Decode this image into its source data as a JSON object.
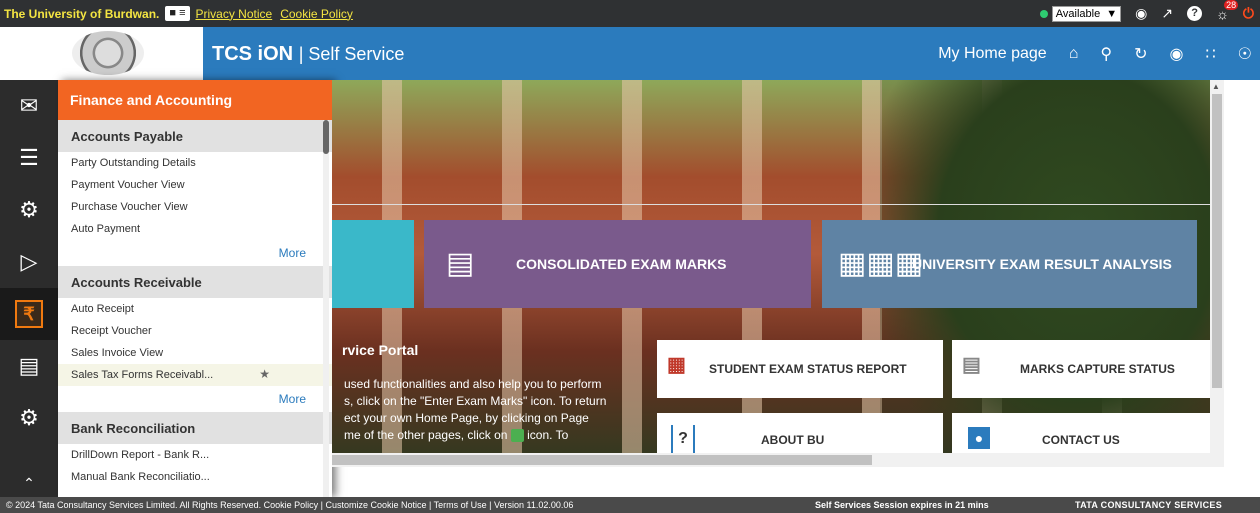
{
  "topbar": {
    "university": "The University of Burdwan.",
    "user_badge": "≡",
    "privacy": "Privacy Notice",
    "cookie": "Cookie Policy",
    "status": "Available",
    "notification_count": "28"
  },
  "header": {
    "brand": "TCS iON",
    "brand_suffix": "| Self Service",
    "home_label": "My Home page"
  },
  "flyout": {
    "title": "Finance and Accounting",
    "sections": [
      {
        "name": "Accounts Payable",
        "items": [
          "Party Outstanding Details",
          "Payment Voucher View",
          "Purchase Voucher View",
          "Auto Payment"
        ],
        "more": "More"
      },
      {
        "name": "Accounts Receivable",
        "items": [
          "Auto Receipt",
          "Receipt Voucher",
          "Sales Invoice View",
          "Sales Tax Forms Receivabl..."
        ],
        "more": "More"
      },
      {
        "name": "Bank Reconciliation",
        "items": [
          "DrillDown Report - Bank R...",
          "Manual Bank Reconciliatio..."
        ]
      }
    ]
  },
  "tiles": {
    "consolidated": "CONSOLIDATED EXAM MARKS",
    "analysis": "UNIVERSITY EXAM RESULT ANALYSIS"
  },
  "portal": {
    "title": "rvice Portal",
    "line1": "used functionalities and also help you to perform",
    "line2": "s, click on the \"Enter Exam Marks\" icon. To return",
    "line3": "ect your own Home Page, by clicking on Page",
    "line4a": "me of the other pages, click on",
    "line4b": "icon. To"
  },
  "cards": {
    "student": "STUDENT EXAM STATUS REPORT",
    "marks": "MARKS CAPTURE STATUS",
    "about": "ABOUT BU",
    "contact": "CONTACT US"
  },
  "footer": {
    "copyright": "© 2024 Tata Consultancy Services Limited. All Rights Reserved.   Cookie Policy | Customize Cookie Notice | Terms of Use | Version 11.02.00.06",
    "session": "Self Services Session expires in 21 mins",
    "company": "TATA CONSULTANCY SERVICES"
  }
}
